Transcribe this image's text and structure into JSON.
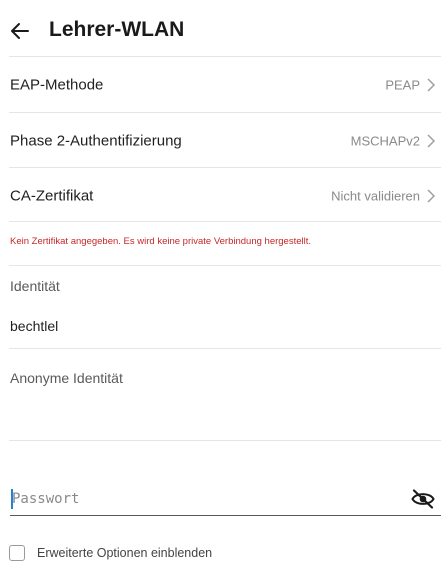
{
  "header": {
    "title": "Lehrer-WLAN",
    "back_icon": "arrow-left-icon"
  },
  "settings": [
    {
      "label": "EAP-Methode",
      "value": "PEAP"
    },
    {
      "label": "Phase 2-Authentifizierung",
      "value": "MSCHAPv2"
    },
    {
      "label": "CA-Zertifikat",
      "value": "Nicht validieren"
    }
  ],
  "warning": "Kein Zertifikat angegeben. Es wird keine private Verbindung hergestellt.",
  "identity": {
    "label": "Identität",
    "value": "bechtlel"
  },
  "anonymous_identity": {
    "label": "Anonyme Identität",
    "value": ""
  },
  "password": {
    "placeholder": "Passwort",
    "value": "",
    "toggle_icon": "eye-off-icon"
  },
  "advanced": {
    "label": "Erweiterte Optionen einblenden",
    "checked": false
  },
  "colors": {
    "warning": "#c62828",
    "cursor": "#2b7ddc",
    "secondary_text": "#8a8a8a"
  }
}
